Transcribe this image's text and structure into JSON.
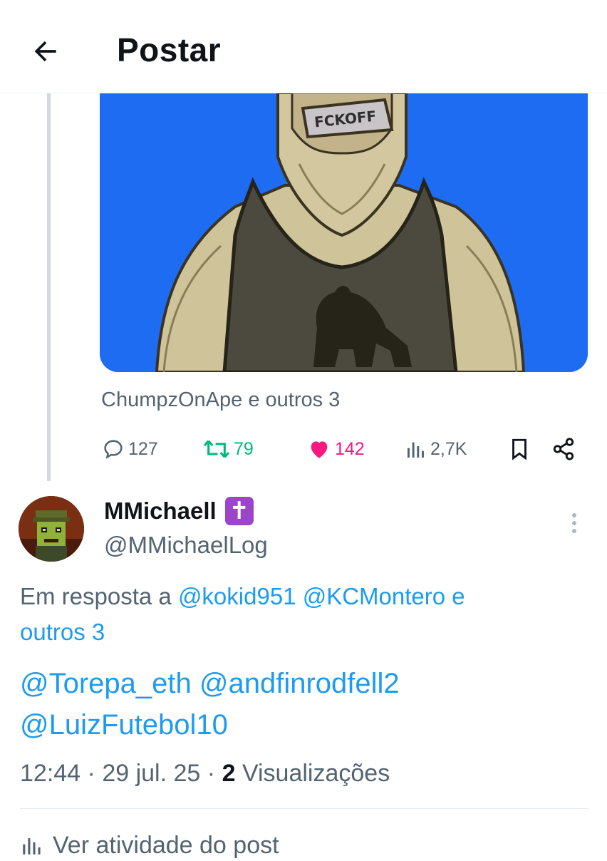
{
  "header": {
    "title": "Postar",
    "back_icon": "arrow-left-icon"
  },
  "media": {
    "label": "FCKOFF"
  },
  "post": {
    "likers": "ChumpzOnApe e outros 3",
    "stats": {
      "replies": "127",
      "reposts": "79",
      "likes": "142",
      "views": "2,7K"
    }
  },
  "reply": {
    "display_name": "MMichaell",
    "badge": "✝",
    "handle": "@MMichaelLog",
    "reply_prefix": "Em resposta a",
    "reply_to": [
      "@kokid951",
      "@KCMontero"
    ],
    "reply_conj": "e",
    "reply_others": "outros 3",
    "mentions": [
      "@Torepa_eth",
      "@andfinrodfell2",
      "@LuizFutebol10"
    ],
    "time": "12:44",
    "date": "29 jul. 25",
    "views_count": "2",
    "views_label": "Visualizações",
    "activity_label": "Ver atividade do post"
  },
  "colors": {
    "accent": "#1d9bf0",
    "like": "#f91880",
    "repost": "#00ba7c",
    "muted": "#536471",
    "media_bg": "#1d6cf2"
  }
}
